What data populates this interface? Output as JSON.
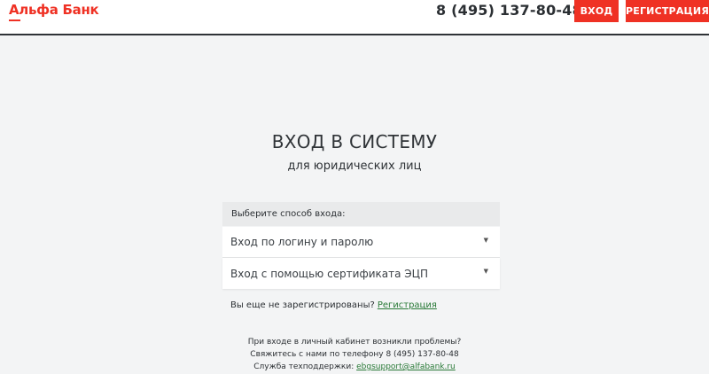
{
  "header": {
    "logo_text": "Альфа Банк",
    "phone": "8 (495) 137-80-48",
    "login_label": "ВХОД",
    "register_label": "РЕГИСТРАЦИЯ"
  },
  "main": {
    "title": "ВХОД В СИСТЕМУ",
    "subtitle": "для юридических лиц",
    "method_header": "Выберите способ входа:",
    "options": [
      {
        "label": "Вход по логину и паролю",
        "icon": "chevron-down-icon"
      },
      {
        "label": "Вход с помощью сертификата ЭЦП",
        "icon": "chevron-down-icon"
      }
    ],
    "not_registered": "Вы еще не зарегистрированы?",
    "register_link": "Регистрация"
  },
  "help": {
    "line1": "При входе в личный кабинет возникли проблемы?",
    "line2": "Свяжитесь с нами по телефону 8 (495) 137-80-48",
    "line3_label": "Служба техподдержки:",
    "email": "ebgsupport@alfabank.ru"
  },
  "colors": {
    "brand": "#ef3124",
    "link": "#2a7a38",
    "background": "#f3f4f5"
  }
}
